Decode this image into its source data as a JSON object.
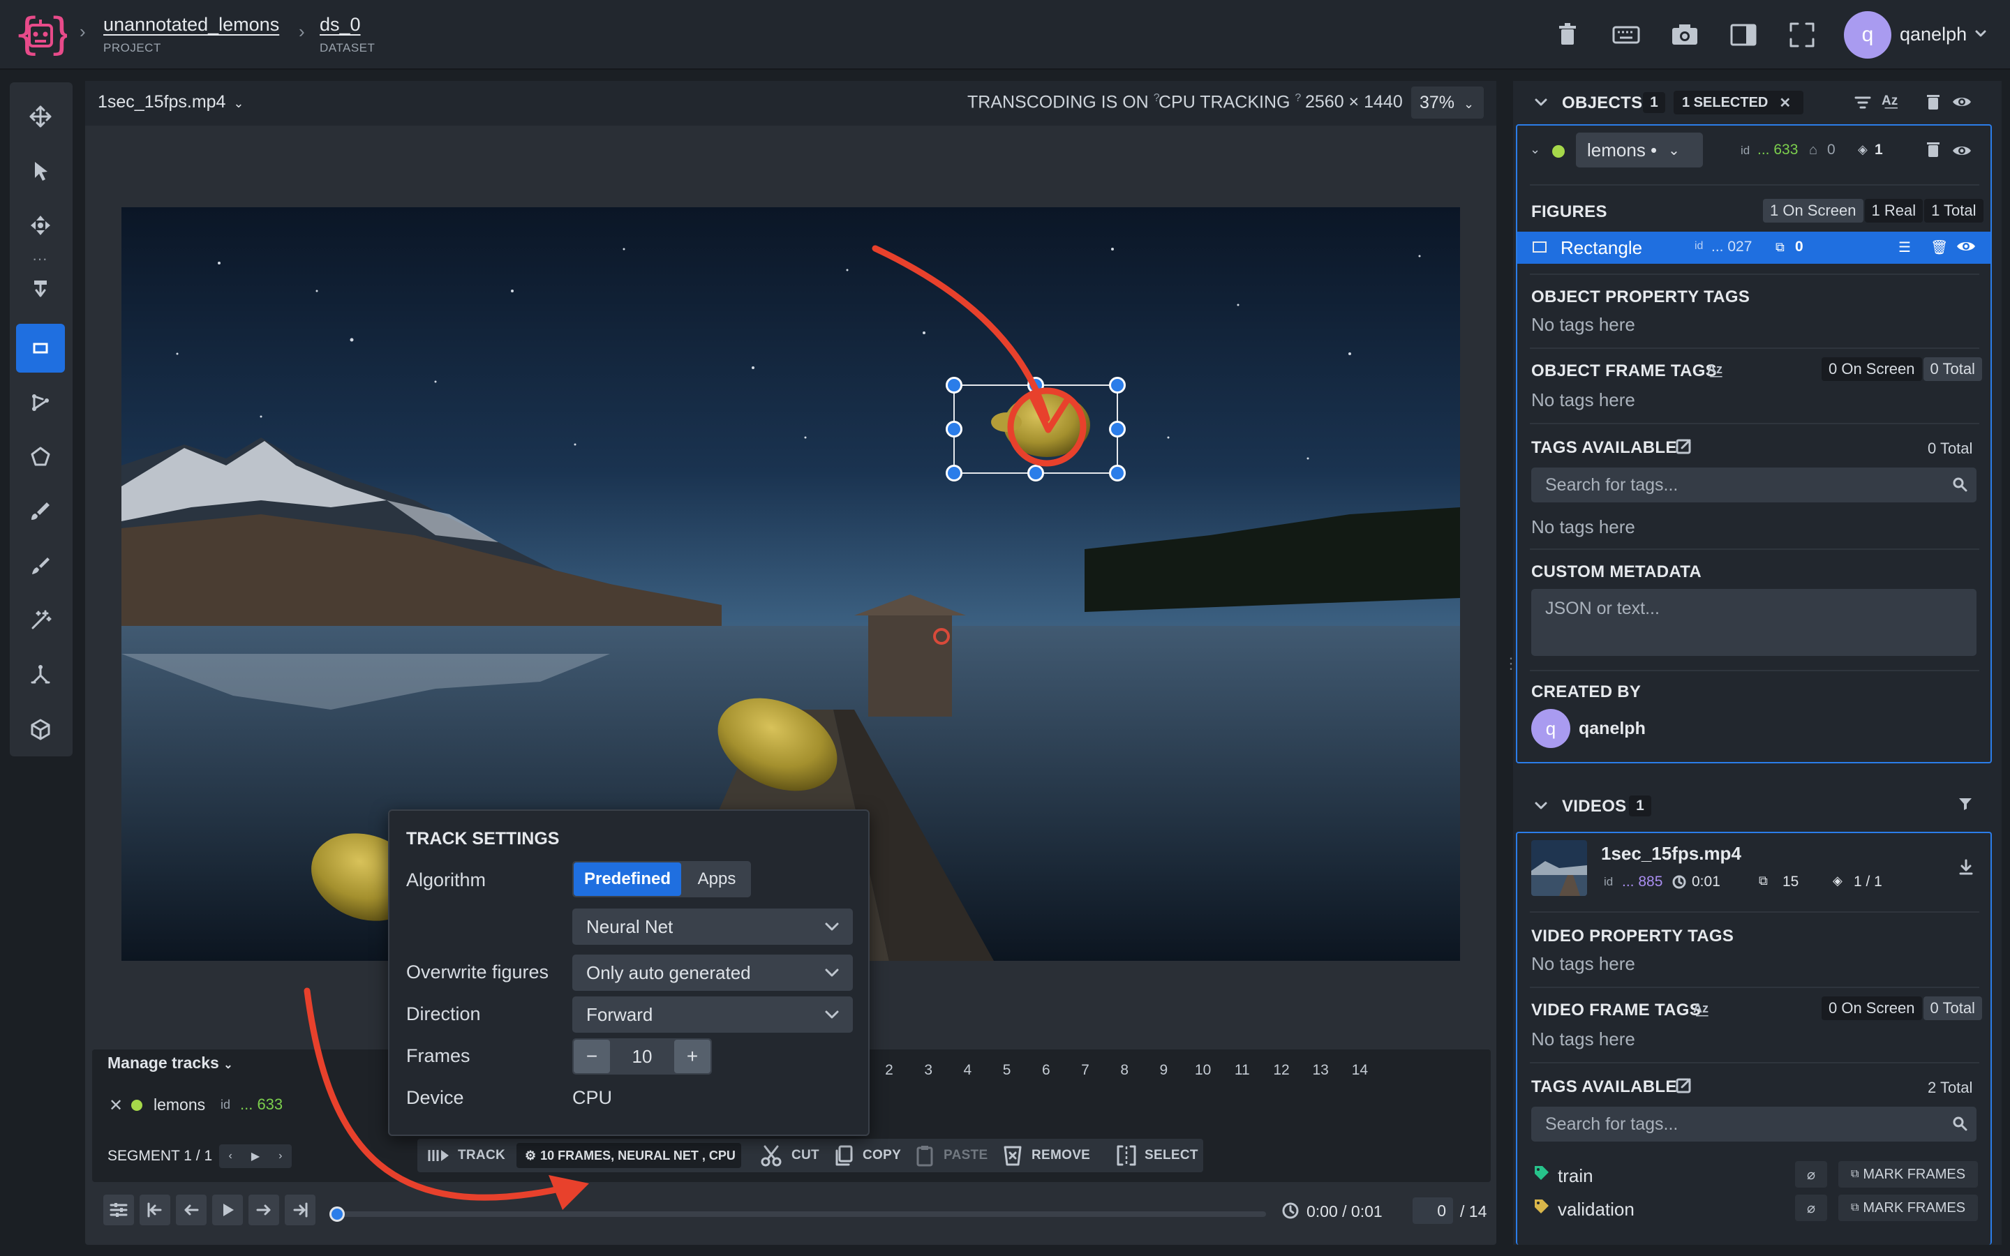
{
  "header": {
    "project": {
      "title": "unannotated_lemons",
      "sub": "PROJECT"
    },
    "dataset": {
      "title": "ds_0",
      "sub": "DATASET"
    },
    "user": {
      "initial": "q",
      "name": "qanelph"
    },
    "icons": [
      "trash-icon",
      "keyboard-icon",
      "camera-icon",
      "panel-toggle-icon",
      "fullscreen-icon"
    ]
  },
  "toolbar": {
    "tools": [
      "move-icon",
      "pointer-icon",
      "pan-icon",
      "anchor-icon",
      "rectangle-icon",
      "graph-icon",
      "polygon-icon",
      "brush-icon",
      "smart-brush-icon",
      "magic-wand-icon",
      "skeleton-icon",
      "cuboid-icon"
    ]
  },
  "infobar": {
    "file": "1sec_15fps.mp4",
    "transcoding": "TRANSCODING IS ON",
    "tracking": "CPU TRACKING",
    "q": "?",
    "resolution": "2560 × 1440",
    "zoom": "37%"
  },
  "track_settings": {
    "title": "TRACK SETTINGS",
    "algorithm_label": "Algorithm",
    "tab_predefined": "Predefined",
    "tab_apps": "Apps",
    "algorithm_value": "Neural Net",
    "overwrite_label": "Overwrite figures",
    "overwrite_value": "Only auto generated",
    "direction_label": "Direction",
    "direction_value": "Forward",
    "frames_label": "Frames",
    "frames_value": "10",
    "frames_minus": "−",
    "frames_plus": "+",
    "device_label": "Device",
    "device_value": "CPU"
  },
  "timeline": {
    "manage_tracks": "Manage tracks",
    "track_name": "lemons",
    "track_id_label": "id",
    "track_id": "... 633",
    "segment": "SEGMENT 1 / 1",
    "frame_numbers": [
      "2",
      "3",
      "4",
      "5",
      "6",
      "7",
      "8",
      "9",
      "10",
      "11",
      "12",
      "13",
      "14"
    ],
    "actions": {
      "track": "TRACK",
      "track_config": "10 FRAMES, NEURAL NET , CPU",
      "cut": "CUT",
      "copy": "COPY",
      "paste": "PASTE",
      "remove": "REMOVE",
      "select": "SELECT"
    },
    "time": "0:00 / 0:01",
    "frame_current": "0",
    "frame_total": "/ 14",
    "progress": 0
  },
  "objects_panel": {
    "title": "OBJECTS",
    "count": "1",
    "selected": "1 SELECTED",
    "object": {
      "class": "lemons •",
      "id_label": "id",
      "id": "... 633",
      "tags": "0",
      "layers": "1"
    },
    "figures_title": "FIGURES",
    "figures_on_screen": "1 On Screen",
    "figures_real": "1 Real",
    "figures_total": "1 Total",
    "figure": {
      "name": "Rectangle",
      "id_label": "id",
      "id": "... 027",
      "count": "0"
    },
    "obj_prop_tags_title": "OBJECT PROPERTY TAGS",
    "obj_prop_tags_empty": "No tags here",
    "obj_frame_tags_title": "OBJECT FRAME TAGS",
    "obj_frame_on_screen": "0 On Screen",
    "obj_frame_total": "0 Total",
    "obj_frame_tags_empty": "No tags here",
    "tags_available_title": "TAGS AVAILABLE",
    "tags_available_total": "0 Total",
    "search_placeholder": "Search for tags...",
    "tags_available_empty": "No tags here",
    "custom_metadata_title": "CUSTOM METADATA",
    "custom_metadata_placeholder": "JSON or text...",
    "created_by_title": "CREATED BY",
    "created_by_initial": "q",
    "created_by_name": "qanelph"
  },
  "videos_panel": {
    "title": "VIDEOS",
    "count": "1",
    "video": {
      "name": "1sec_15fps.mp4",
      "id_label": "id",
      "id": "... 885",
      "duration": "0:01",
      "frames": "15",
      "layers": "1 / 1"
    },
    "video_prop_tags_title": "VIDEO PROPERTY TAGS",
    "video_prop_tags_empty": "No tags here",
    "video_frame_tags_title": "VIDEO FRAME TAGS",
    "video_frame_on_screen": "0 On Screen",
    "video_frame_total": "0 Total",
    "video_frame_tags_empty": "No tags here",
    "tags_available_title": "TAGS AVAILABLE",
    "tags_available_total": "2 Total",
    "search_placeholder": "Search for tags...",
    "tags": [
      {
        "name": "train",
        "color": "#27c38b",
        "action": "MARK FRAMES"
      },
      {
        "name": "validation",
        "color": "#d9b64a",
        "action": "MARK FRAMES"
      }
    ]
  },
  "colors": {
    "accent": "#1f6fe0",
    "object_dot": "#a6d84a",
    "id_green": "#7ccf4d",
    "id_purple": "#a98ef0",
    "annotation_arrow": "#e8412c"
  }
}
